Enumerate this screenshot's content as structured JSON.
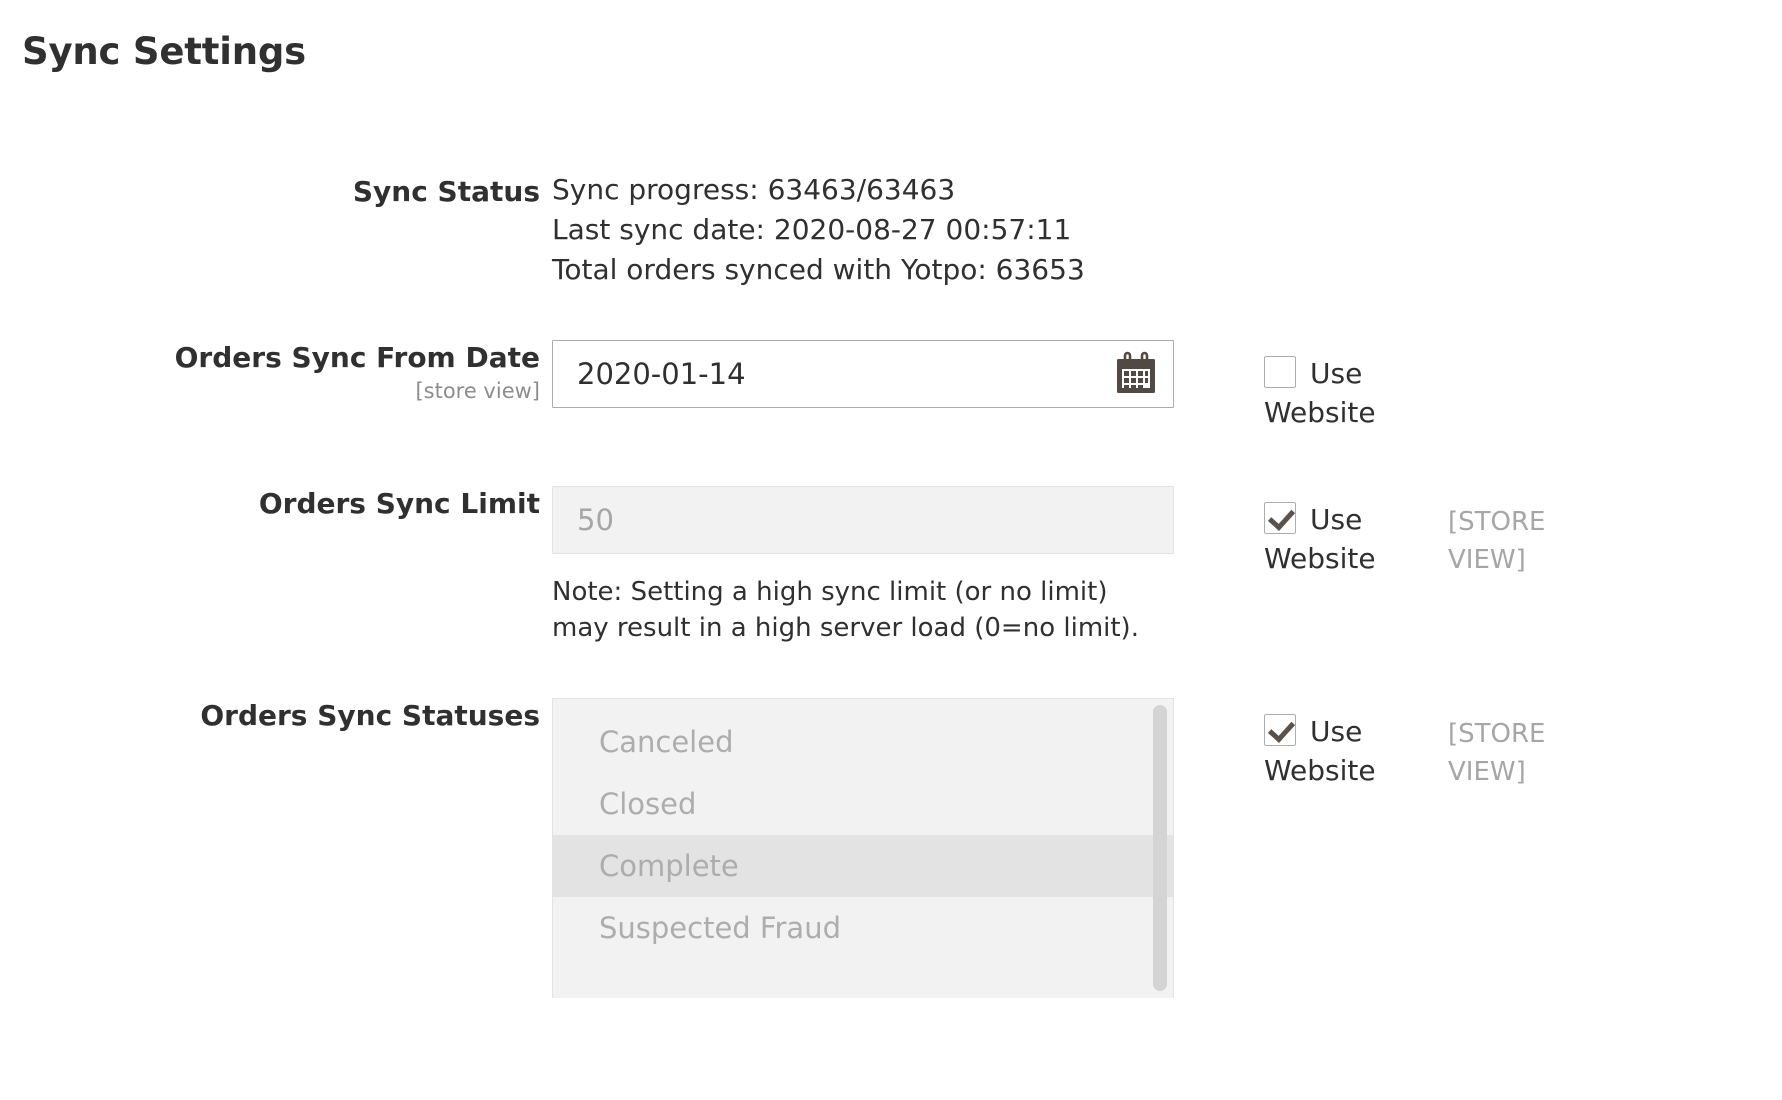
{
  "page": {
    "title": "Sync Settings"
  },
  "fields": {
    "sync_status": {
      "label": "Sync Status",
      "lines": [
        "Sync progress: 63463/63463",
        "Last sync date: 2020-08-27 00:57:11",
        "Total orders synced with Yotpo: 63653"
      ]
    },
    "orders_sync_from_date": {
      "label": "Orders Sync From Date",
      "scope": "[store view]",
      "value": "2020-01-14",
      "calendar_icon": "calendar-icon",
      "inherit": {
        "label": "Use Website",
        "checked": false
      }
    },
    "orders_sync_limit": {
      "label": "Orders Sync Limit",
      "value": "50",
      "disabled": true,
      "note": "Note: Setting a high sync limit (or no limit) may result in a high server load (0=no limit).",
      "inherit": {
        "label": "Use Website",
        "checked": true
      },
      "scope_tag": "[STORE VIEW]"
    },
    "orders_sync_statuses": {
      "label": "Orders Sync Statuses",
      "options": [
        {
          "label": "Canceled",
          "selected": false
        },
        {
          "label": "Closed",
          "selected": false
        },
        {
          "label": "Complete",
          "selected": true
        },
        {
          "label": "Suspected Fraud",
          "selected": false
        }
      ],
      "inherit": {
        "label": "Use Website",
        "checked": true
      },
      "scope_tag": "[STORE VIEW]"
    }
  },
  "colors": {
    "text": "#303030",
    "muted": "#a6a6a6",
    "border": "#adadad",
    "disabled_bg": "#f2f2f2",
    "selected_bg": "#e3e3e3",
    "icon": "#514943"
  }
}
